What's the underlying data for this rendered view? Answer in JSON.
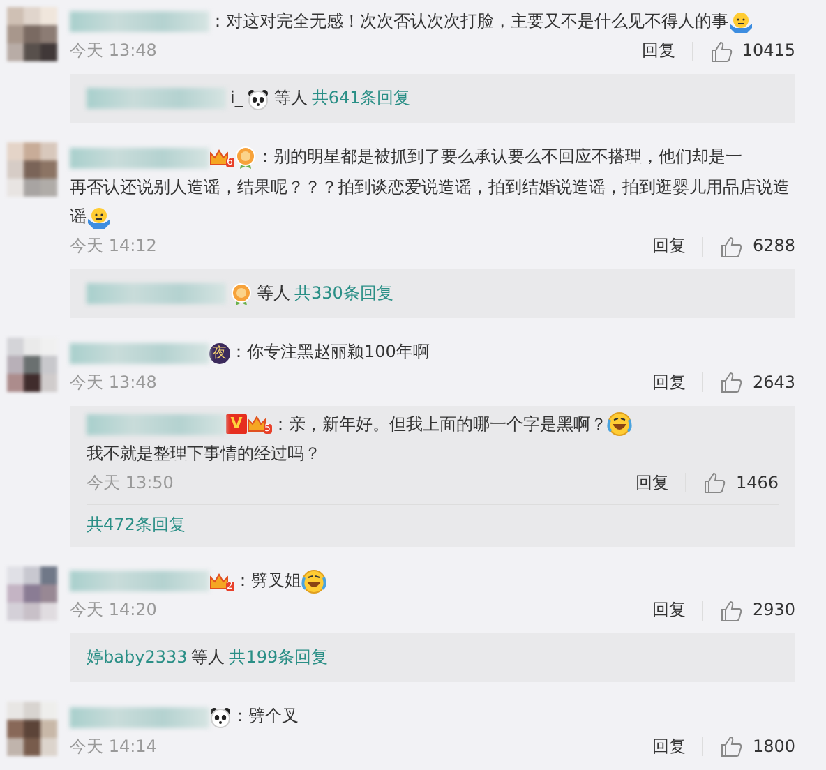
{
  "comments": [
    {
      "head": [
        {
          "kind": "blur"
        },
        {
          "kind": "text",
          "text": "："
        }
      ],
      "body": [
        {
          "kind": "text",
          "text": "对这对完全无感！次次否认次次打脸，主要又不是什么见不得人的事"
        },
        {
          "kind": "shrug"
        }
      ],
      "time": "今天 13:48",
      "reply": "回复",
      "likes": "10415",
      "thread": {
        "kind": "summary",
        "parts": [
          {
            "kind": "blur"
          },
          {
            "kind": "text",
            "text": "i_"
          },
          {
            "kind": "panda"
          },
          {
            "kind": "text",
            "text": "等人"
          },
          {
            "kind": "link",
            "text": "共641条回复"
          }
        ]
      }
    },
    {
      "head": [
        {
          "kind": "blur"
        },
        {
          "kind": "crown",
          "label": "6"
        },
        {
          "kind": "medal"
        },
        {
          "kind": "text",
          "text": "："
        }
      ],
      "body": [
        {
          "kind": "text",
          "text": "别的明星都是被抓到了要么承认要么不回应不搭理，他们却是一"
        },
        {
          "kind": "text",
          "text": "再否认还说别人造谣，结果呢？？？拍到谈恋爱说造谣，拍到结婚说造谣，拍到逛婴儿用品店说造"
        },
        {
          "kind": "text",
          "text": "谣"
        },
        {
          "kind": "shrug"
        }
      ],
      "time": "今天 14:12",
      "reply": "回复",
      "likes": "6288",
      "thread": {
        "kind": "summary",
        "parts": [
          {
            "kind": "blur"
          },
          {
            "kind": "medal"
          },
          {
            "kind": "text",
            "text": "等人"
          },
          {
            "kind": "link",
            "text": "共330条回复"
          }
        ]
      }
    },
    {
      "head": [
        {
          "kind": "blur"
        },
        {
          "kind": "night",
          "label": "夜"
        },
        {
          "kind": "text",
          "text": "："
        }
      ],
      "body": [
        {
          "kind": "text",
          "text": "你专注黑赵丽颖100年啊"
        }
      ],
      "time": "今天 13:48",
      "reply": "回复",
      "likes": "2643",
      "thread": {
        "kind": "nested",
        "head": [
          {
            "kind": "blur"
          },
          {
            "kind": "verified",
            "label": "V"
          },
          {
            "kind": "crown",
            "label": "5"
          },
          {
            "kind": "text",
            "text": "："
          }
        ],
        "body": [
          {
            "kind": "text",
            "text": "亲，新年好。但我上面的哪一个字是黑啊？"
          },
          {
            "kind": "laugh"
          },
          {
            "kind": "text",
            "text": "我不就是整理下事情的经"
          },
          {
            "kind": "text",
            "text": "过吗？"
          }
        ],
        "time": "今天 13:50",
        "reply": "回复",
        "likes": "1466",
        "more": "共472条回复"
      }
    },
    {
      "head": [
        {
          "kind": "blur"
        },
        {
          "kind": "crown",
          "label": "2"
        },
        {
          "kind": "text",
          "text": "："
        }
      ],
      "body": [
        {
          "kind": "text",
          "text": "劈叉姐"
        },
        {
          "kind": "laugh"
        }
      ],
      "time": "今天 14:20",
      "reply": "回复",
      "likes": "2930",
      "thread": {
        "kind": "summary",
        "parts": [
          {
            "kind": "link",
            "text": "婷baby2333"
          },
          {
            "kind": "text",
            "text": "等人"
          },
          {
            "kind": "link",
            "text": "共199条回复"
          }
        ]
      }
    },
    {
      "head": [
        {
          "kind": "blur"
        },
        {
          "kind": "panda"
        },
        {
          "kind": "text",
          "text": "："
        }
      ],
      "body": [
        {
          "kind": "text",
          "text": "劈个叉"
        }
      ],
      "time": "今天 14:14",
      "reply": "回复",
      "likes": "1800"
    }
  ]
}
